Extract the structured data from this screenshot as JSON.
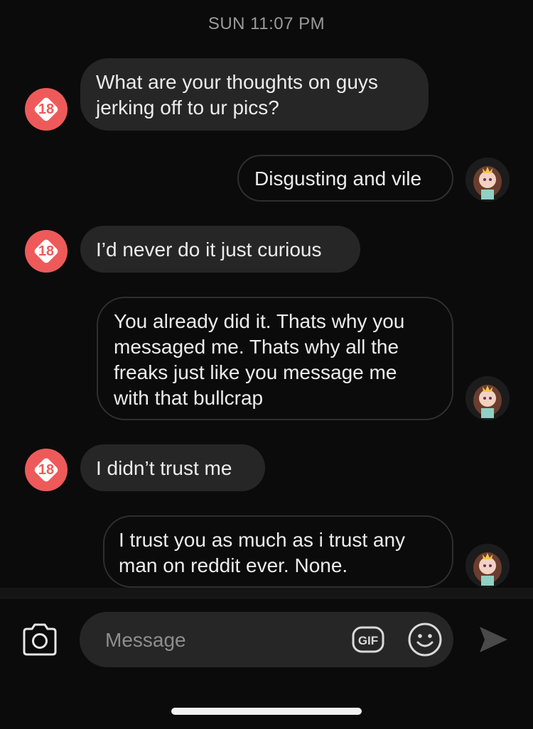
{
  "timestamp": "SUN 11:07 PM",
  "other_avatar_text": "18",
  "messages": [
    {
      "from": "them",
      "lines": [
        "What are your thoughts on guys",
        "jerking off to ur pics?"
      ]
    },
    {
      "from": "me",
      "lines": [
        "Disgusting and vile"
      ]
    },
    {
      "from": "them",
      "lines": [
        "I’d never do it just curious"
      ]
    },
    {
      "from": "me",
      "lines": [
        "You already did it. Thats why you",
        "messaged me. Thats why all the",
        "freaks just like you message me",
        "with that bullcrap"
      ]
    },
    {
      "from": "them",
      "lines": [
        "I didn’t trust me"
      ]
    },
    {
      "from": "me",
      "lines": [
        "I trust you as much as i trust any",
        "man on reddit ever. None."
      ]
    }
  ],
  "composer": {
    "placeholder": "Message",
    "gif_label": "GIF",
    "icons": {
      "camera": "camera-icon",
      "gif": "gif-icon",
      "emoji": "smiley-icon",
      "send": "send-icon"
    }
  },
  "colors": {
    "avatar_badge": "#ee5a5a",
    "incoming_bubble": "#262626",
    "outgoing_border": "#2f2f2f"
  }
}
